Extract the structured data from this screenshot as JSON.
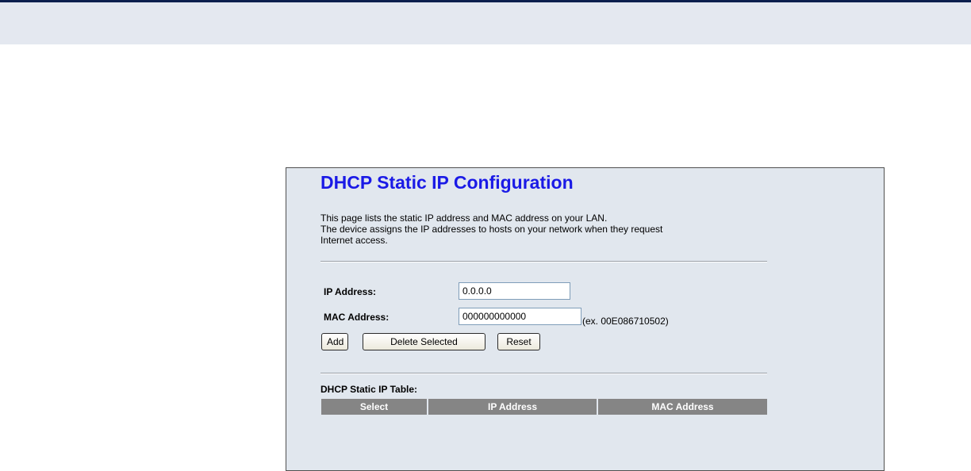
{
  "page": {
    "title": "DHCP Static IP Configuration",
    "intro_lines": [
      "This page lists the static IP address and MAC address on your LAN.",
      "The device assigns the IP addresses to hosts on your network when they request",
      "Internet access."
    ]
  },
  "form": {
    "ip_label": "IP Address:",
    "ip_value": "0.0.0.0",
    "mac_label": "MAC Address:",
    "mac_value": "000000000000",
    "mac_example": "(ex. 00E086710502)"
  },
  "buttons": {
    "add": "Add",
    "delete_selected": "Delete Selected",
    "reset": "Reset"
  },
  "table": {
    "title": "DHCP Static IP Table:",
    "columns": [
      "Select",
      "IP Address",
      "MAC Address"
    ]
  },
  "colors": {
    "title_blue": "#1a1ae6",
    "panel_bg": "#e1e7ee",
    "header_gray": "#858585",
    "top_rule": "#0c1f4e"
  }
}
